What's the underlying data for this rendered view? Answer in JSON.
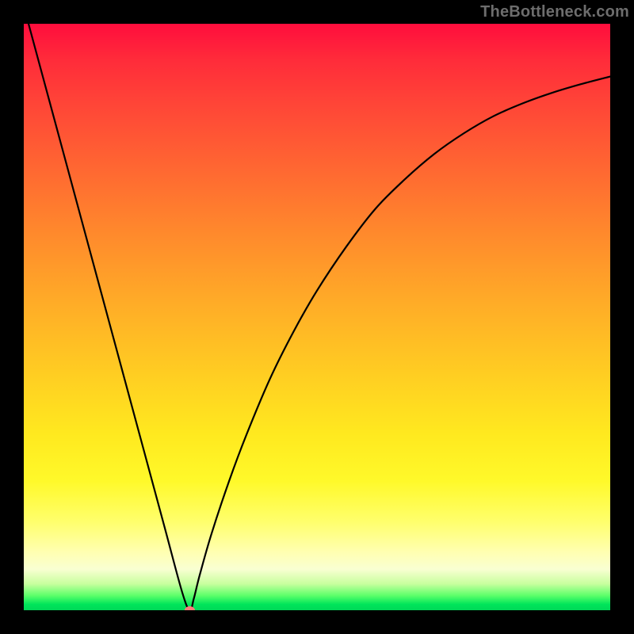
{
  "watermark": "TheBottleneck.com",
  "chart_data": {
    "type": "line",
    "title": "",
    "xlabel": "",
    "ylabel": "",
    "xlim": [
      0,
      100
    ],
    "ylim": [
      0,
      100
    ],
    "series": [
      {
        "name": "curve",
        "x": [
          0,
          5,
          10,
          15,
          20,
          24,
          27,
          28.3,
          29,
          30,
          32,
          35,
          38,
          42,
          46,
          50,
          55,
          60,
          65,
          70,
          75,
          80,
          85,
          90,
          95,
          100
        ],
        "values": [
          103,
          84.5,
          66,
          47.5,
          29,
          14.2,
          3.1,
          0,
          2,
          6,
          13,
          22,
          30,
          39.5,
          47.5,
          54.5,
          62,
          68.5,
          73.5,
          77.8,
          81.3,
          84.2,
          86.4,
          88.2,
          89.7,
          91
        ]
      }
    ],
    "marker": {
      "x": 28.3,
      "y": 0,
      "color": "#ff7b7b"
    },
    "gradient_stops": [
      {
        "pos": 0.0,
        "color": "#ff0d3d"
      },
      {
        "pos": 0.5,
        "color": "#ffb825"
      },
      {
        "pos": 0.8,
        "color": "#ffff55"
      },
      {
        "pos": 0.96,
        "color": "#bfff8f"
      },
      {
        "pos": 1.0,
        "color": "#00d858"
      }
    ]
  }
}
